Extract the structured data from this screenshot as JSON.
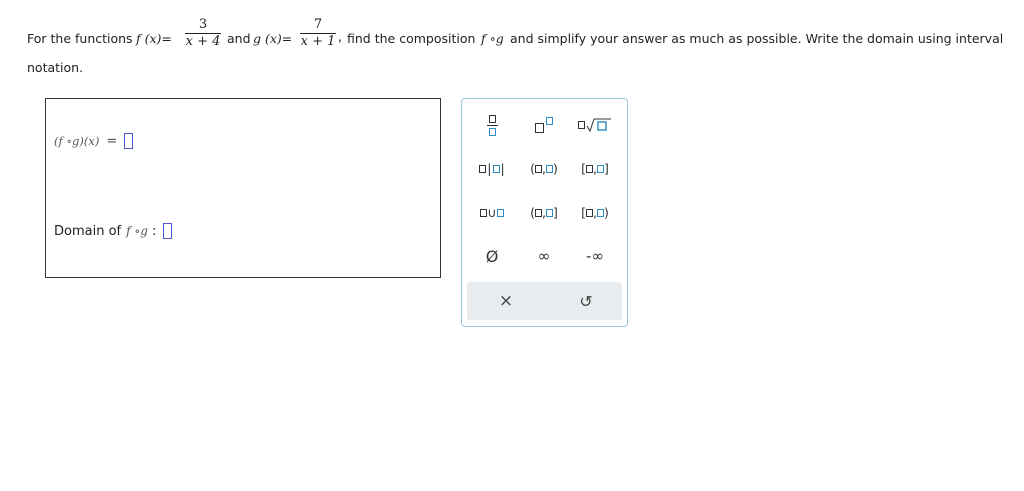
{
  "question": {
    "intro": "For the functions",
    "f_name": "f (x)=",
    "f_num": "3",
    "f_den": "x + 4",
    "and": "and",
    "g_name": "g (x)=",
    "g_num": "7",
    "g_den": "x + 1",
    "sep": ",",
    "instruction": "find the composition",
    "comp_symbol": "f ∘g",
    "instruction_rest": "and simplify your answer as much as possible. Write the domain using interval",
    "line2": "notation."
  },
  "answer": {
    "composition_label": "(f ∘g)(x)",
    "equals": "=",
    "domain_label": "Domain of",
    "domain_math": "f ∘g",
    "domain_colon": ":"
  },
  "palette": {
    "buttons": [
      {
        "name": "fraction-button",
        "label": ""
      },
      {
        "name": "superscript-button",
        "label": ""
      },
      {
        "name": "nth-root-button",
        "label": ""
      },
      {
        "name": "absolute-value-button",
        "label": ""
      },
      {
        "name": "open-interval-button",
        "label": ""
      },
      {
        "name": "closed-interval-button",
        "label": ""
      },
      {
        "name": "union-button",
        "label": ""
      },
      {
        "name": "left-open-interval-button",
        "label": ""
      },
      {
        "name": "right-open-interval-button",
        "label": ""
      },
      {
        "name": "empty-set-button",
        "label": "Ø"
      },
      {
        "name": "infinity-button",
        "label": "∞"
      },
      {
        "name": "negative-infinity-button",
        "label": "-∞"
      }
    ],
    "clear_icon": "×",
    "undo_icon": "↺",
    "accent": "#2a8fc0",
    "slot_color": "#4a56d6"
  }
}
